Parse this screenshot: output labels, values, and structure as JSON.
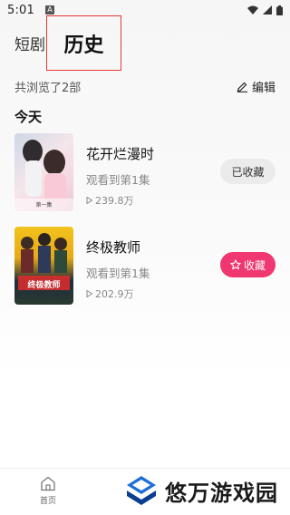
{
  "status_bar": {
    "time": "5:01",
    "notif": "A"
  },
  "top_tabs": {
    "short_drama": "短剧",
    "history": "历史"
  },
  "summary": {
    "text": "共浏览了2部",
    "edit_label": "编辑"
  },
  "section": {
    "title": "今天"
  },
  "items": [
    {
      "title": "花开烂漫时",
      "progress": "观看到第1集",
      "views": "239.8万",
      "fav_label": "已收藏",
      "favorited": true,
      "poster_caption": "第一集"
    },
    {
      "title": "终极教师",
      "progress": "观看到第1集",
      "views": "202.9万",
      "fav_label": "收藏",
      "favorited": false,
      "poster_caption": "终极教师"
    }
  ],
  "bottom_nav": {
    "home_label": "首页"
  },
  "watermark": {
    "text": "悠万游戏园"
  },
  "colors": {
    "accent": "#f0376f",
    "saved_bg": "#ebebeb",
    "highlight_box": "#e53935"
  }
}
